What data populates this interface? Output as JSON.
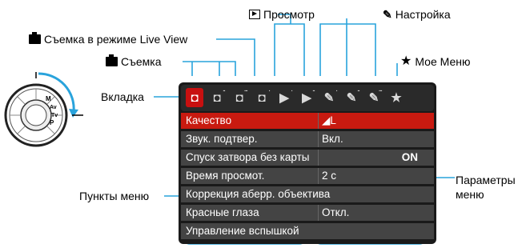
{
  "callouts": {
    "playback": "Просмотр",
    "setup": "Настройка",
    "live_view_shooting": "Съемка в режиме Live View",
    "shooting": "Съемка",
    "my_menu": "Мое Меню",
    "tab": "Вкладка",
    "menu_items": "Пункты меню",
    "menu_settings_line1": "Параметры",
    "menu_settings_line2": "меню"
  },
  "icons": {
    "camera": "camera-icon",
    "playback": "play-icon",
    "setup": "wrench-icon",
    "my_menu": "star-icon"
  },
  "tabs": [
    {
      "icon": "camera-icon",
      "glyph": "◘",
      "dots": "",
      "active": true
    },
    {
      "icon": "camera-icon",
      "glyph": "◘",
      "dots": "··",
      "active": false
    },
    {
      "icon": "camera-icon",
      "glyph": "◘",
      "dots": "···",
      "active": false
    },
    {
      "icon": "live-view-icon",
      "glyph": "◘",
      "dots": "·",
      "active": false
    },
    {
      "icon": "play-icon",
      "glyph": "▶",
      "dots": "·",
      "active": false
    },
    {
      "icon": "play-icon",
      "glyph": "▶",
      "dots": "··",
      "active": false
    },
    {
      "icon": "wrench-icon",
      "glyph": "✎",
      "dots": "·",
      "active": false
    },
    {
      "icon": "wrench-icon",
      "glyph": "✎",
      "dots": "··",
      "active": false
    },
    {
      "icon": "wrench-icon",
      "glyph": "✎",
      "dots": "···",
      "active": false
    },
    {
      "icon": "star-icon",
      "glyph": "★",
      "dots": "",
      "active": false
    }
  ],
  "menu": [
    {
      "label": "Качество",
      "value": "◢L",
      "selected": true,
      "value_align": "left"
    },
    {
      "label": "Звук. подтвер.",
      "value": "Вкл.",
      "selected": false,
      "value_align": "left"
    },
    {
      "label": "Спуск затвора без карты",
      "value": "ON",
      "selected": false,
      "value_align": "right"
    },
    {
      "label": "Время просмот.",
      "value": "2 с",
      "selected": false,
      "value_align": "left"
    },
    {
      "label": "Коррекция аберр. объектива",
      "value": "",
      "selected": false,
      "value_align": "left"
    },
    {
      "label": "Красные глаза",
      "value": "Откл.",
      "selected": false,
      "value_align": "left"
    },
    {
      "label": "Управление вспышкой",
      "value": "",
      "selected": false,
      "value_align": "left"
    }
  ],
  "dial_labels": [
    "M",
    "Av",
    "Tv",
    "P",
    "A+"
  ],
  "colors": {
    "callout_line": "#29a3dc",
    "active_tab": "#c81010",
    "selected_row": "#c81a10",
    "screen_bg": "#1a1a1a",
    "row_bg": "#444444"
  }
}
